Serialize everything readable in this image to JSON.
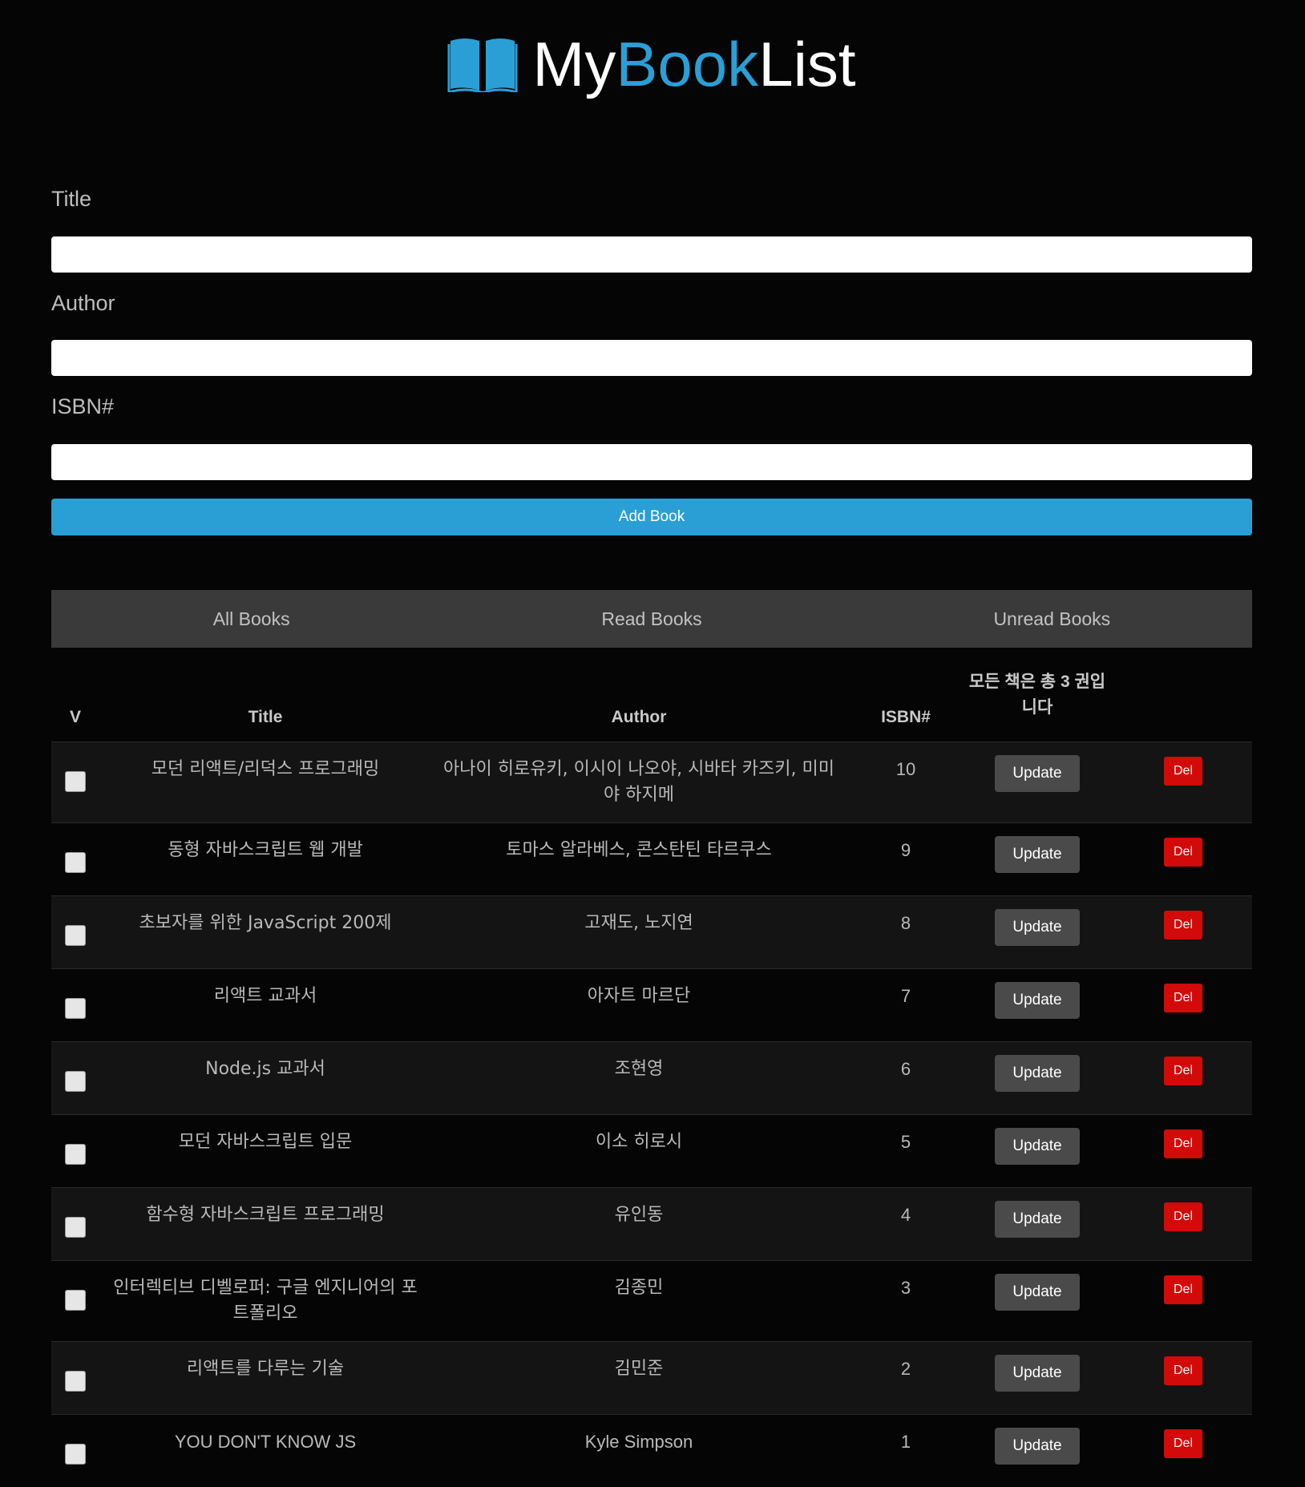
{
  "header": {
    "brand_my": "My",
    "brand_book": "Book",
    "brand_list": "List",
    "accent_color": "#2a9fd6",
    "logo_icon": "open-book-icon"
  },
  "form": {
    "title_label": "Title",
    "title_value": "",
    "author_label": "Author",
    "author_value": "",
    "isbn_label": "ISBN#",
    "isbn_value": "",
    "add_button": "Add Book"
  },
  "tabs": [
    {
      "label": "All Books"
    },
    {
      "label": "Read Books"
    },
    {
      "label": "Unread Books"
    }
  ],
  "table": {
    "headers": {
      "check": "V",
      "title": "Title",
      "author": "Author",
      "isbn": "ISBN#",
      "count": "모든 책은 총 3 권입니다"
    },
    "update_label": "Update",
    "delete_label": "Del",
    "rows": [
      {
        "title": "모던 리액트/리덕스 프로그래밍",
        "author": "아나이 히로유키, 이시이 나오야, 시바타 카즈키, 미미야 하지메",
        "isbn": "10"
      },
      {
        "title": "동형 자바스크립트 웹 개발",
        "author": "토마스 알라베스, 콘스탄틴 타르쿠스",
        "isbn": "9"
      },
      {
        "title": "초보자를 위한 JavaScript 200제",
        "author": "고재도, 노지연",
        "isbn": "8"
      },
      {
        "title": "리액트 교과서",
        "author": "아자트 마르단",
        "isbn": "7"
      },
      {
        "title": "Node.js 교과서",
        "author": "조현영",
        "isbn": "6"
      },
      {
        "title": "모던 자바스크립트 입문",
        "author": "이소 히로시",
        "isbn": "5"
      },
      {
        "title": "함수형 자바스크립트 프로그래밍",
        "author": "유인동",
        "isbn": "4"
      },
      {
        "title": "인터렉티브 디벨로퍼: 구글 엔지니어의 포트폴리오",
        "author": "김종민",
        "isbn": "3"
      },
      {
        "title": "리액트를 다루는 기술",
        "author": "김민준",
        "isbn": "2"
      },
      {
        "title": "YOU DON'T KNOW JS",
        "author": "Kyle Simpson",
        "isbn": "1"
      }
    ]
  }
}
